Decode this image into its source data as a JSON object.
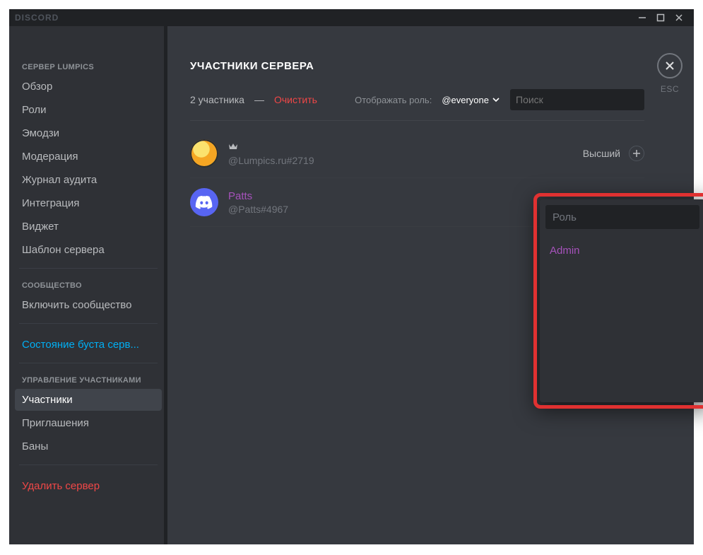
{
  "titlebar": {
    "brand": "DISCORD"
  },
  "sidebar": {
    "header1": "СЕРВЕР LUMPICS",
    "items1": [
      "Обзор",
      "Роли",
      "Эмодзи",
      "Модерация",
      "Журнал аудита",
      "Интеграция",
      "Виджет",
      "Шаблон сервера"
    ],
    "header2": "СООБЩЕСТВО",
    "community_item": "Включить сообщество",
    "boost_item": "Состояние буста серв...",
    "header3": "УПРАВЛЕНИЕ УЧАСТНИКАМИ",
    "items3": [
      "Участники",
      "Приглашения",
      "Баны"
    ],
    "delete_item": "Удалить сервер"
  },
  "main": {
    "title": "УЧАСТНИКИ СЕРВЕРА",
    "count_text": "2 участника",
    "dash": "—",
    "clear": "Очистить",
    "role_filter_label": "Отображать роль:",
    "role_filter_value": "@everyone",
    "search_placeholder": "Поиск"
  },
  "members": [
    {
      "display_name": "",
      "tag": "@Lumpics.ru#2719",
      "owner": true,
      "highest_label": "Высший"
    },
    {
      "display_name": "Patts",
      "tag": "@Patts#4967",
      "owner": false
    }
  ],
  "popout": {
    "placeholder": "Роль",
    "items": [
      "Admin"
    ]
  },
  "close": {
    "esc": "ESC"
  }
}
